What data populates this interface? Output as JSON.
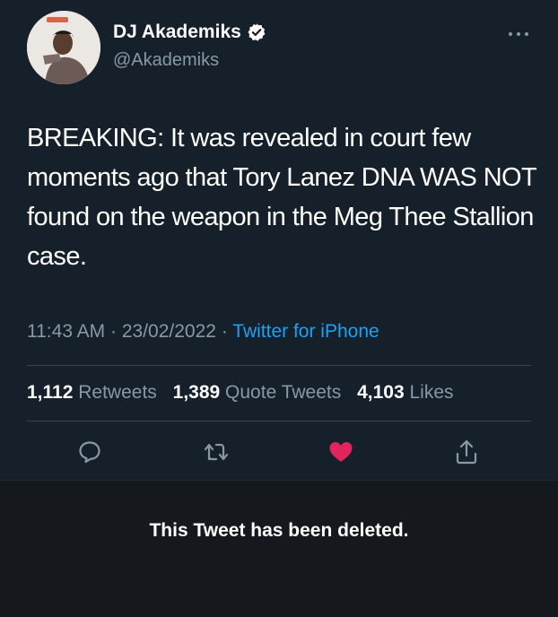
{
  "author": {
    "display_name": "DJ Akademiks",
    "handle": "@Akademiks",
    "verified": true,
    "avatar_icon": "profile-photo-avatar"
  },
  "tweet": {
    "text": "BREAKING: It was revealed in court few moments ago that Tory Lanez DNA WAS NOT found on the weapon in the Meg Thee Stallion case.",
    "time": "11:43 AM",
    "date": "23/02/2022",
    "separator": "·",
    "source": "Twitter for iPhone"
  },
  "stats": {
    "retweets_count": "1,112",
    "retweets_label": "Retweets",
    "quotes_count": "1,389",
    "quotes_label": "Quote Tweets",
    "likes_count": "4,103",
    "likes_label": "Likes"
  },
  "actions": {
    "reply_icon": "reply-icon",
    "retweet_icon": "retweet-icon",
    "like_icon": "heart-icon",
    "share_icon": "share-icon",
    "liked": true
  },
  "status": {
    "deleted_message": "This Tweet has been deleted."
  },
  "colors": {
    "background": "#15202b",
    "secondary_text": "#8899a6",
    "link": "#1da1f2",
    "like_active": "#e0245e",
    "divider": "#38444d"
  }
}
